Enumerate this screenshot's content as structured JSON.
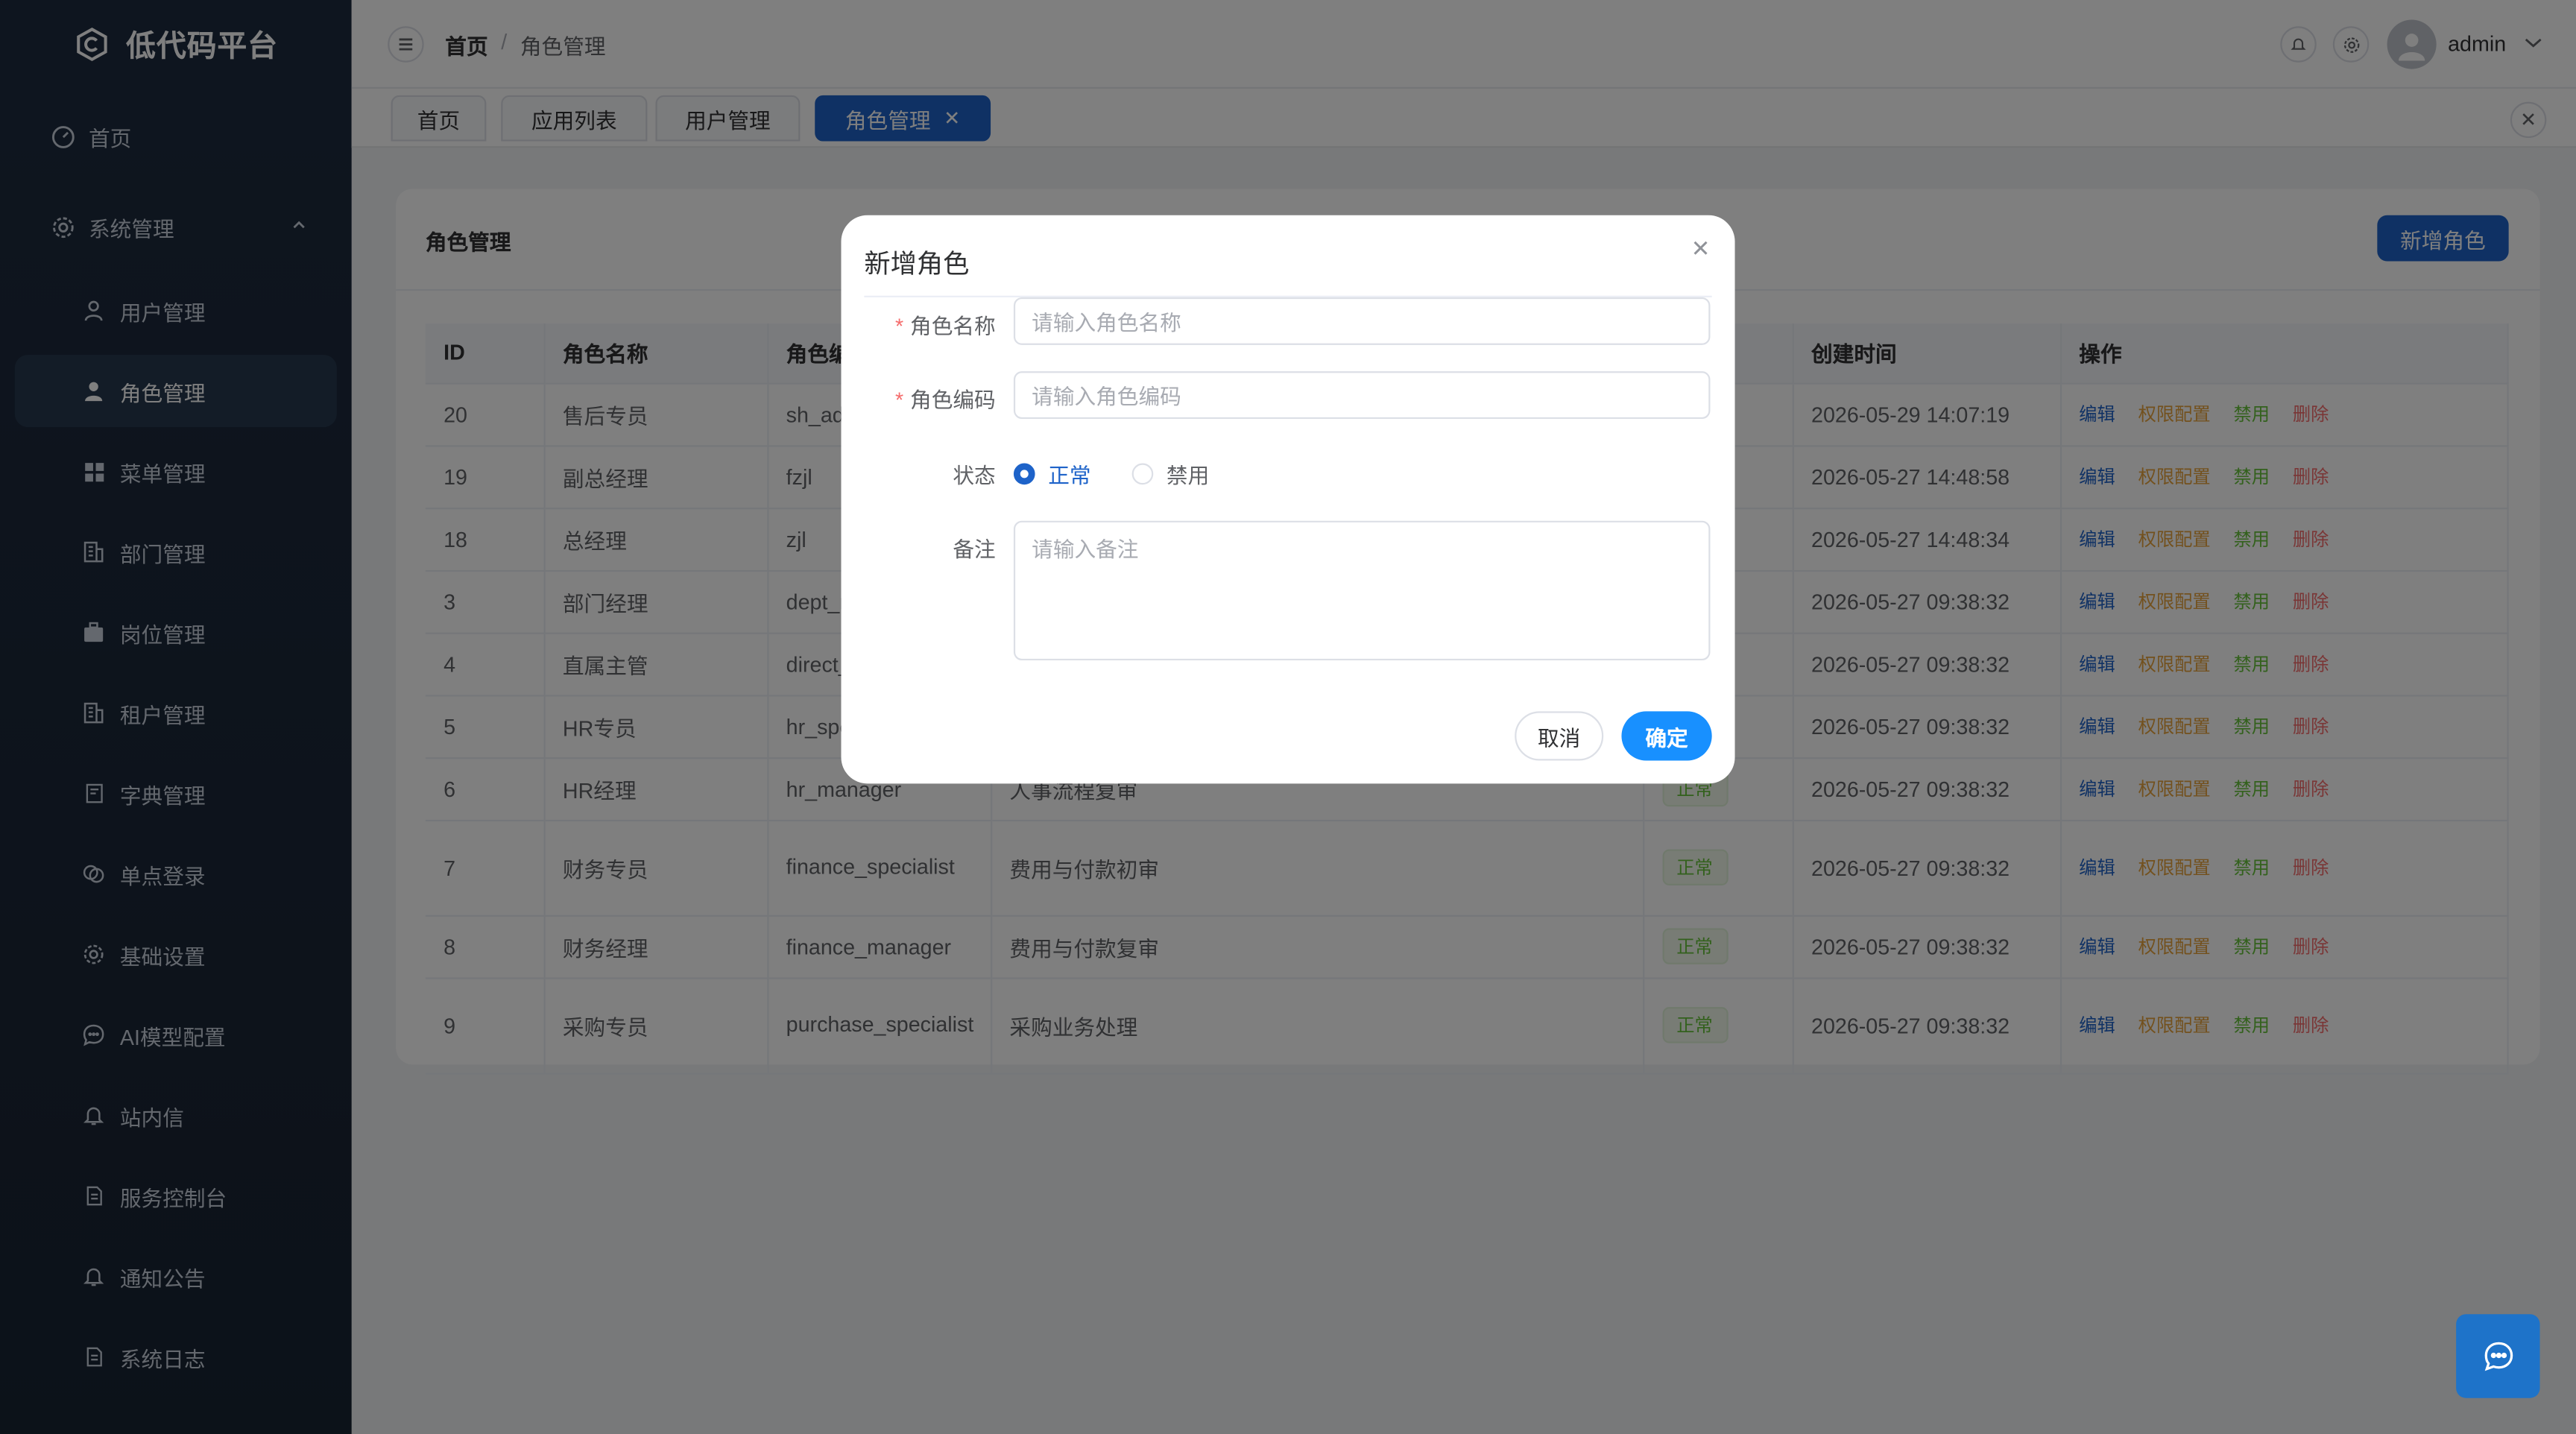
{
  "app": {
    "title": "低代码平台"
  },
  "sidebar": {
    "items": [
      {
        "label": "首页",
        "icon": "dashboard-icon"
      },
      {
        "label": "系统管理",
        "icon": "gear-icon"
      },
      {
        "label": "用户管理",
        "icon": "user-icon"
      },
      {
        "label": "角色管理",
        "icon": "user-filled-icon"
      },
      {
        "label": "菜单管理",
        "icon": "grid-icon"
      },
      {
        "label": "部门管理",
        "icon": "building-icon"
      },
      {
        "label": "岗位管理",
        "icon": "briefcase-icon"
      },
      {
        "label": "租户管理",
        "icon": "building-icon"
      },
      {
        "label": "字典管理",
        "icon": "book-icon"
      },
      {
        "label": "单点登录",
        "icon": "link-icon"
      },
      {
        "label": "基础设置",
        "icon": "gear-icon"
      },
      {
        "label": "AI模型配置",
        "icon": "chat-icon"
      },
      {
        "label": "站内信",
        "icon": "bell-icon"
      },
      {
        "label": "服务控制台",
        "icon": "document-icon"
      },
      {
        "label": "通知公告",
        "icon": "bell-icon"
      },
      {
        "label": "系统日志",
        "icon": "document-icon"
      }
    ]
  },
  "header": {
    "breadcrumb": {
      "home": "首页",
      "sep": "/",
      "current": "角色管理"
    },
    "user": "admin"
  },
  "tabs": [
    "首页",
    "应用列表",
    "用户管理",
    "角色管理"
  ],
  "card": {
    "title": "角色管理",
    "add_button": "新增角色",
    "columns": [
      "ID",
      "角色名称",
      "角色编码",
      "",
      "",
      "创建时间",
      "操作"
    ],
    "rows": [
      {
        "id": "20",
        "name": "售后专员",
        "code": "sh_admin",
        "desc": "",
        "status": "",
        "time": "2026-05-29 14:07:19"
      },
      {
        "id": "19",
        "name": "副总经理",
        "code": "fzjl",
        "desc": "",
        "status": "",
        "time": "2026-05-27 14:48:58"
      },
      {
        "id": "18",
        "name": "总经理",
        "code": "zjl",
        "desc": "",
        "status": "",
        "time": "2026-05-27 14:48:34"
      },
      {
        "id": "3",
        "name": "部门经理",
        "code": "dept_manager",
        "desc": "",
        "status": "",
        "time": "2026-05-27 09:38:32"
      },
      {
        "id": "4",
        "name": "直属主管",
        "code": "direct_leader",
        "desc": "",
        "status": "",
        "time": "2026-05-27 09:38:32"
      },
      {
        "id": "5",
        "name": "HR专员",
        "code": "hr_specialist",
        "desc": "",
        "status": "",
        "time": "2026-05-27 09:38:32"
      },
      {
        "id": "6",
        "name": "HR经理",
        "code": "hr_manager",
        "desc": "人事流程复审",
        "status": "正常",
        "time": "2026-05-27 09:38:32"
      },
      {
        "id": "7",
        "name": "财务专员",
        "code": "finance_specialist",
        "desc": "费用与付款初审",
        "status": "正常",
        "time": "2026-05-27 09:38:32"
      },
      {
        "id": "8",
        "name": "财务经理",
        "code": "finance_manager",
        "desc": "费用与付款复审",
        "status": "正常",
        "time": "2026-05-27 09:38:32"
      },
      {
        "id": "9",
        "name": "采购专员",
        "code": "purchase_specialist",
        "desc": "采购业务处理",
        "status": "正常",
        "time": "2026-05-27 09:38:32"
      }
    ],
    "ops": {
      "edit": "编辑",
      "perm": "权限配置",
      "ban": "禁用",
      "del": "删除"
    }
  },
  "dialog": {
    "title": "新增角色",
    "name_label": "角色名称",
    "name_placeholder": "请输入角色名称",
    "code_label": "角色编码",
    "code_placeholder": "请输入角色编码",
    "status_label": "状态",
    "status_options": [
      "正常",
      "禁用"
    ],
    "status_selected": "正常",
    "remark_label": "备注",
    "remark_placeholder": "请输入备注",
    "cancel": "取消",
    "ok": "确定"
  },
  "colors": {
    "primary": "#1e63c9",
    "sidebar": "#1d2b3f",
    "ok_button": "#1890ff",
    "success": "#67c23a",
    "warning": "#e6a23c",
    "danger": "#f56c6c"
  }
}
